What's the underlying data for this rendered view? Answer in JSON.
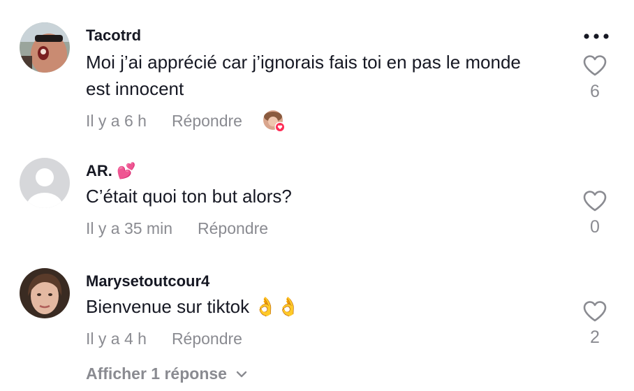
{
  "comments": [
    {
      "username": "Tacotrd",
      "text": "Moi j’ai apprécié car j’ignorais fais toi en pas le monde est innocent",
      "time": "Il y a 6 h",
      "reply_label": "Répondre",
      "likes": "6"
    },
    {
      "username": "AR. 💕",
      "text": "C’était quoi ton but alors?",
      "time": "Il y a 35 min",
      "reply_label": "Répondre",
      "likes": "0"
    },
    {
      "username": "Marysetoutcour4",
      "text": "Bienvenue sur tiktok 👌👌",
      "time": "Il y a 4 h",
      "reply_label": "Répondre",
      "likes": "2",
      "view_replies": "Afficher 1 réponse"
    }
  ],
  "colors": {
    "primary_text": "#161823",
    "secondary_text": "#8a8b91",
    "creator_like_badge": "#fe2c55"
  },
  "icons": {
    "more": "more-dots-icon",
    "like": "heart-outline-icon",
    "expand": "chevron-down-icon"
  }
}
